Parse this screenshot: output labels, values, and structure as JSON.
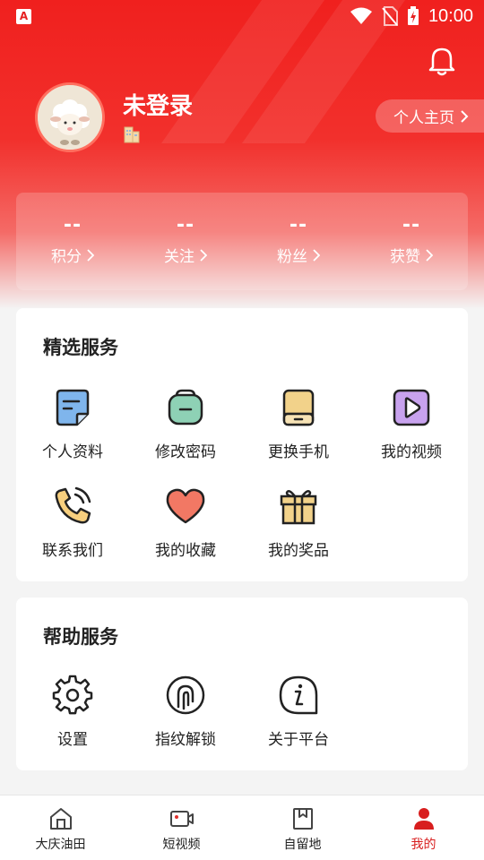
{
  "status_bar": {
    "time": "10:00",
    "app_badge": "A"
  },
  "profile": {
    "username": "未登录",
    "homepage_label": "个人主页"
  },
  "stats": [
    {
      "value": "--",
      "label": "积分"
    },
    {
      "value": "--",
      "label": "关注"
    },
    {
      "value": "--",
      "label": "粉丝"
    },
    {
      "value": "--",
      "label": "获赞"
    }
  ],
  "featured": {
    "title": "精选服务",
    "items": [
      {
        "label": "个人资料",
        "icon": "profile-card-icon"
      },
      {
        "label": "修改密码",
        "icon": "lock-icon"
      },
      {
        "label": "更换手机",
        "icon": "phone-icon"
      },
      {
        "label": "我的视频",
        "icon": "video-icon"
      },
      {
        "label": "联系我们",
        "icon": "call-icon"
      },
      {
        "label": "我的收藏",
        "icon": "heart-icon"
      },
      {
        "label": "我的奖品",
        "icon": "gift-icon"
      }
    ]
  },
  "help": {
    "title": "帮助服务",
    "items": [
      {
        "label": "设置",
        "icon": "gear-icon"
      },
      {
        "label": "指纹解锁",
        "icon": "fingerprint-icon"
      },
      {
        "label": "关于平台",
        "icon": "info-icon"
      }
    ]
  },
  "tabbar": {
    "items": [
      {
        "label": "大庆油田",
        "icon": "home-icon"
      },
      {
        "label": "短视频",
        "icon": "video-camera-icon"
      },
      {
        "label": "自留地",
        "icon": "bookmark-icon"
      },
      {
        "label": "我的",
        "icon": "person-icon"
      }
    ]
  },
  "colors": {
    "brand_red": "#f0201e",
    "active_tab": "#d81e1e"
  }
}
